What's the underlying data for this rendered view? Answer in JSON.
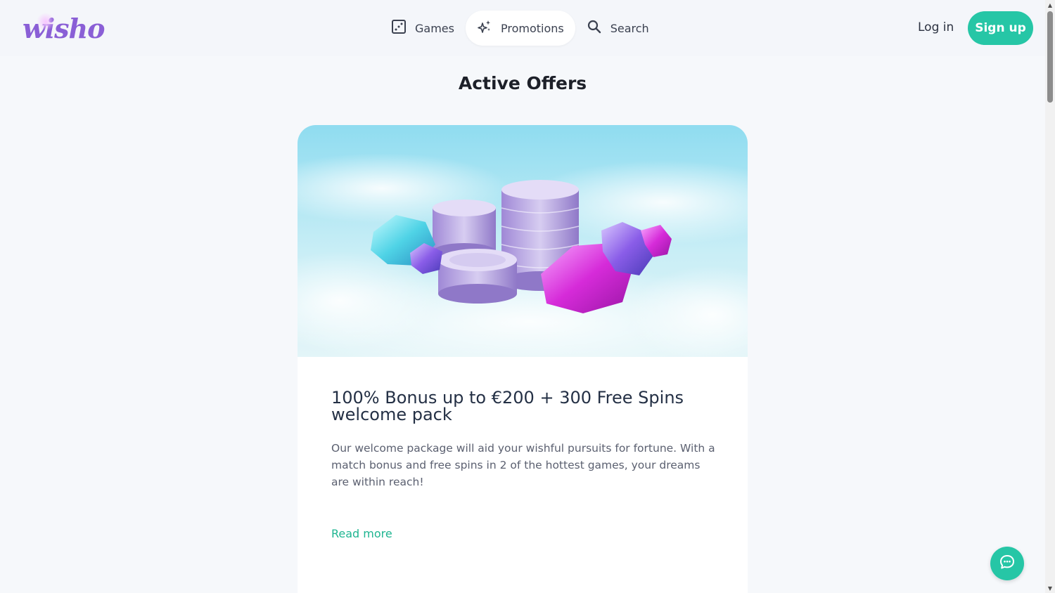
{
  "brand": {
    "logo_text": "wisho"
  },
  "nav": {
    "items": [
      {
        "label": "Games",
        "icon": "dice-icon"
      },
      {
        "label": "Promotions",
        "icon": "sparkles-icon",
        "active": true
      },
      {
        "label": "Search",
        "icon": "search-icon"
      }
    ]
  },
  "auth": {
    "login_label": "Log in",
    "signup_label": "Sign up"
  },
  "page": {
    "title": "Active Offers"
  },
  "offer": {
    "title": "100% Bonus up to €200 + 300 Free Spins welcome pack",
    "description": "Our welcome package will aid your wishful pursuits for fortune. With a match bonus and free spins in 2 of the hottest games, your dreams are within reach!",
    "read_more_label": "Read more",
    "image": "coins-and-gems-illustration"
  },
  "chat": {
    "icon": "chat-bubble-icon"
  },
  "colors": {
    "accent": "#26c6a6",
    "link": "#1fb591",
    "logo": "#8a5fd6"
  }
}
